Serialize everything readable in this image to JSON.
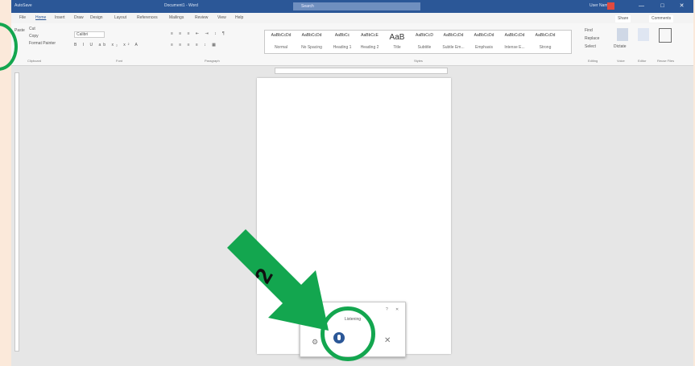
{
  "titlebar": {
    "autosave": "AutoSave",
    "doc_title": "Document1 - Word",
    "search_placeholder": "Search",
    "user": "User Name",
    "minimize": "—",
    "maximize": "□",
    "close": "✕"
  },
  "menu": [
    "File",
    "Home",
    "Insert",
    "Draw",
    "Design",
    "Layout",
    "References",
    "Mailings",
    "Review",
    "View",
    "Help"
  ],
  "share_label": "Share",
  "comments_label": "Comments",
  "ribbon": {
    "clipboard": "Clipboard",
    "font": "Font",
    "paragraph": "Paragraph",
    "styles_group": "Styles",
    "editing": "Editing",
    "voice": "Voice",
    "editor": "Editor",
    "reuse": "Reuse Files",
    "paste": "Paste",
    "cut": "Cut",
    "copy": "Copy",
    "format_painter": "Format Painter",
    "font_name": "Calibri",
    "find": "Find",
    "replace": "Replace",
    "select": "Select",
    "dictate": "Dictate"
  },
  "styles": [
    "Normal",
    "No Spacing",
    "Heading 1",
    "Heading 2",
    "Title",
    "Subtitle",
    "Subtle Em...",
    "Emphasis",
    "Intense E...",
    "Strong"
  ],
  "dictation": {
    "title": "Listening",
    "settings_icon": "gear-icon",
    "mic_icon": "microphone-icon",
    "close_icon": "close-icon"
  },
  "annotation": {
    "step": "2",
    "color": "#13a64f"
  }
}
